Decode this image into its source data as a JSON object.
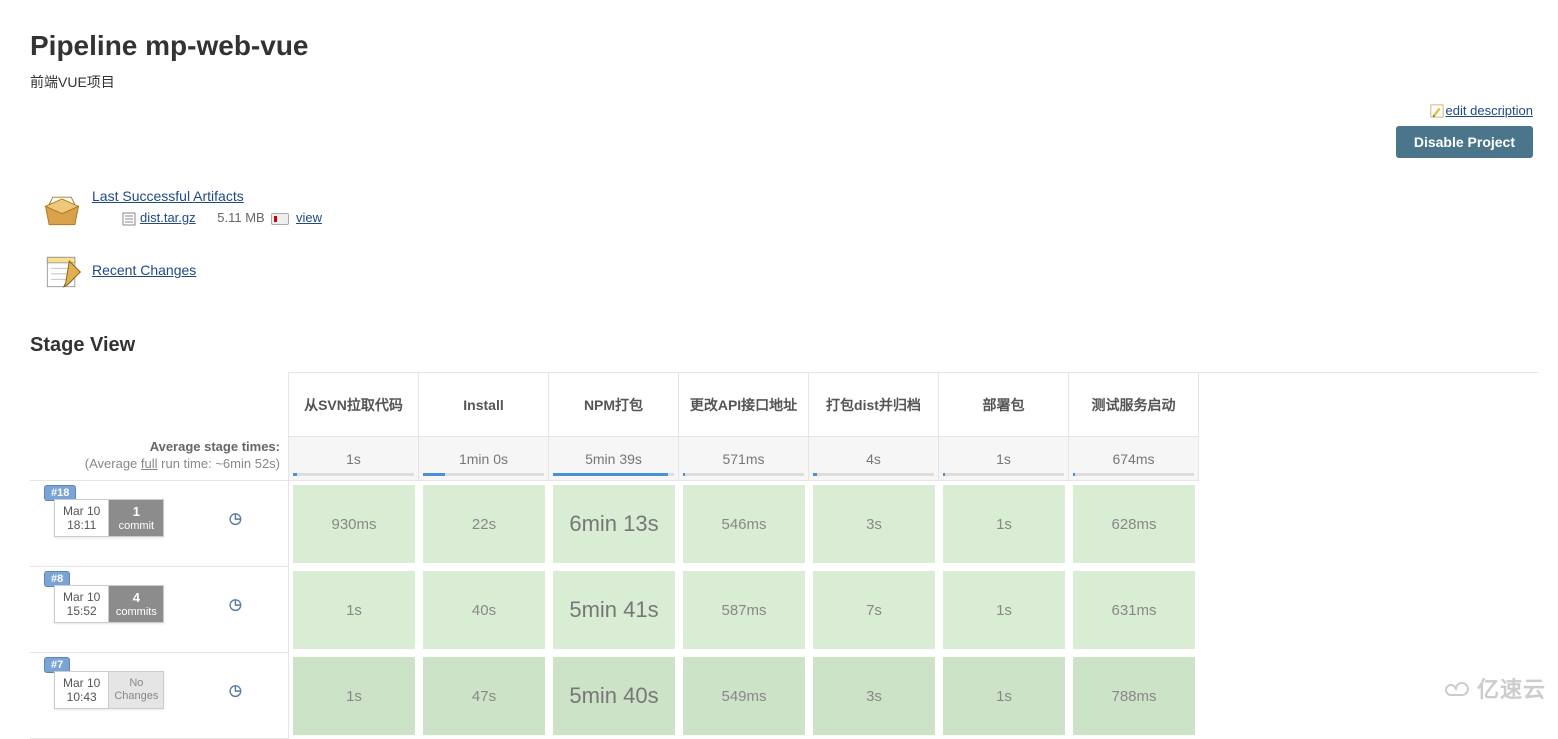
{
  "header": {
    "title": "Pipeline mp-web-vue",
    "description": "前端VUE项目",
    "edit_description": "edit description",
    "disable_project": "Disable Project"
  },
  "artifacts": {
    "title": "Last Successful Artifacts",
    "file": "dist.tar.gz",
    "size": "5.11 MB",
    "view": "view"
  },
  "recent_changes": "Recent Changes",
  "stage_view": {
    "title": "Stage View",
    "avg_label_1": "Average stage times:",
    "avg_label_2a": "(Average ",
    "avg_label_2b": "full",
    "avg_label_2c": " run time: ~6min 52s)",
    "columns": [
      {
        "name": "从SVN拉取代码",
        "avg": "1s",
        "bar": 3
      },
      {
        "name": "Install",
        "avg": "1min 0s",
        "bar": 18
      },
      {
        "name": "NPM打包",
        "avg": "5min 39s",
        "bar": 95
      },
      {
        "name": "更改API接口地址",
        "avg": "571ms",
        "bar": 2
      },
      {
        "name": "打包dist并归档",
        "avg": "4s",
        "bar": 3
      },
      {
        "name": "部署包",
        "avg": "1s",
        "bar": 2
      },
      {
        "name": "测试服务启动",
        "avg": "674ms",
        "bar": 2
      }
    ],
    "runs": [
      {
        "id": "#18",
        "date": "Mar 10",
        "time": "18:11",
        "commits_n": "1",
        "commits_label": "commit",
        "no_changes": false,
        "cells": [
          "930ms",
          "22s",
          "6min 13s",
          "546ms",
          "3s",
          "1s",
          "628ms"
        ]
      },
      {
        "id": "#8",
        "date": "Mar 10",
        "time": "15:52",
        "commits_n": "4",
        "commits_label": "commits",
        "no_changes": false,
        "cells": [
          "1s",
          "40s",
          "5min 41s",
          "587ms",
          "7s",
          "1s",
          "631ms"
        ]
      },
      {
        "id": "#7",
        "date": "Mar 10",
        "time": "10:43",
        "commits_n": "",
        "commits_label": "No Changes",
        "no_changes": true,
        "cells": [
          "1s",
          "47s",
          "5min 40s",
          "549ms",
          "3s",
          "1s",
          "788ms"
        ]
      }
    ]
  },
  "watermark": "亿速云"
}
